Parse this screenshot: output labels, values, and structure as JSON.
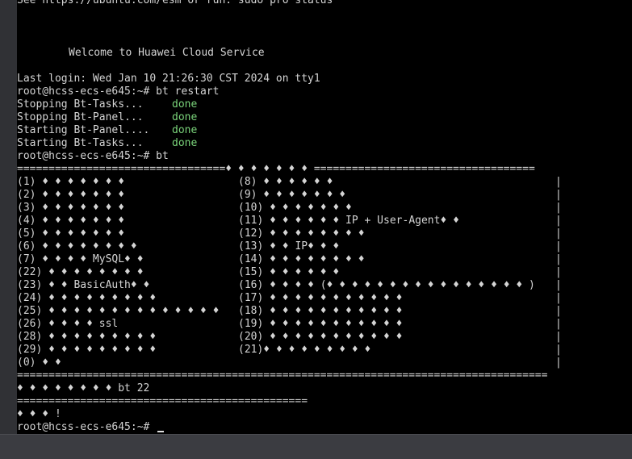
{
  "terminal": {
    "motd_hint": "See https://ubuntu.com/esm or run: sudo pro status",
    "welcome": "Welcome to Huawei Cloud Service",
    "last_login": "Last login: Wed Jan 10 21:26:30 CST 2024 on tty1",
    "prompt1": "root@hcss-ecs-e645:~# bt restart",
    "status": [
      {
        "label": "Stopping Bt-Tasks...",
        "state": "done"
      },
      {
        "label": "Stopping Bt-Panel...",
        "state": "done"
      },
      {
        "label": "Starting Bt-Panel....",
        "state": "done"
      },
      {
        "label": "Starting Bt-Tasks...",
        "state": "done"
      }
    ],
    "prompt2": "root@hcss-ecs-e645:~# bt",
    "menu_top": "=================================♦ ♦ ♦ ♦ ♦ ♦ ♦ ===================================",
    "menu": [
      {
        "left": "(1) ♦ ♦ ♦ ♦ ♦ ♦ ♦",
        "right": "(8) ♦ ♦ ♦ ♦ ♦ ♦"
      },
      {
        "left": "(2) ♦ ♦ ♦ ♦ ♦ ♦ ♦",
        "right": "(9) ♦ ♦ ♦ ♦ ♦ ♦ ♦"
      },
      {
        "left": "(3) ♦ ♦ ♦ ♦ ♦ ♦ ♦",
        "right": "(10) ♦ ♦ ♦ ♦ ♦ ♦ ♦"
      },
      {
        "left": "(4) ♦ ♦ ♦ ♦ ♦ ♦ ♦",
        "right": "(11) ♦ ♦ ♦ ♦ ♦ ♦ IP + User-Agent♦ ♦"
      },
      {
        "left": "(5) ♦ ♦ ♦ ♦ ♦ ♦ ♦",
        "right": "(12) ♦ ♦ ♦ ♦ ♦ ♦ ♦ ♦"
      },
      {
        "left": "(6) ♦ ♦ ♦ ♦ ♦ ♦ ♦ ♦",
        "right": "(13) ♦ ♦ IP♦ ♦ ♦"
      },
      {
        "left": "(7) ♦ ♦ ♦ ♦ MySQL♦ ♦",
        "right": "(14) ♦ ♦ ♦ ♦ ♦ ♦ ♦ ♦"
      },
      {
        "left": "(22) ♦ ♦ ♦ ♦ ♦ ♦ ♦ ♦",
        "right": "(15) ♦ ♦ ♦ ♦ ♦ ♦"
      },
      {
        "left": "(23) ♦ ♦ BasicAuth♦ ♦",
        "right": "(16) ♦ ♦ ♦ ♦ (♦ ♦ ♦ ♦ ♦ ♦ ♦ ♦ ♦ ♦ ♦ ♦ ♦ ♦ ♦ ♦ )"
      },
      {
        "left": "(24) ♦ ♦ ♦ ♦ ♦ ♦ ♦ ♦ ♦",
        "right": "(17) ♦ ♦ ♦ ♦ ♦ ♦ ♦ ♦ ♦ ♦ ♦"
      },
      {
        "left": "(25) ♦ ♦ ♦ ♦ ♦ ♦ ♦ ♦ ♦ ♦ ♦ ♦ ♦ ♦",
        "right": "(18) ♦ ♦ ♦ ♦ ♦ ♦ ♦ ♦ ♦ ♦ ♦"
      },
      {
        "left": "(26) ♦ ♦ ♦ ♦ ssl",
        "right": "(19) ♦ ♦ ♦ ♦ ♦ ♦ ♦ ♦ ♦ ♦ ♦"
      },
      {
        "left": "(28) ♦ ♦ ♦ ♦ ♦ ♦ ♦ ♦ ♦",
        "right": "(20) ♦ ♦ ♦ ♦ ♦ ♦ ♦ ♦ ♦ ♦ ♦"
      },
      {
        "left": "(29) ♦ ♦ ♦ ♦ ♦ ♦ ♦ ♦ ♦",
        "right": "(21)♦ ♦ ♦ ♦ ♦ ♦ ♦ ♦ ♦"
      },
      {
        "left": "(0) ♦ ♦",
        "right": ""
      }
    ],
    "menu_bottom": "====================================================================================",
    "hint": "♦ ♦ ♦ ♦ ♦ ♦ ♦ ♦ bt 22",
    "divider": "==============================================",
    "input_prompt": "♦ ♦ ♦ !",
    "prompt3": "root@hcss-ecs-e645:~# ",
    "vbar": "|",
    "colors": {
      "background": "#000000",
      "text": "#d4d4d4",
      "done": "#7ad37a"
    }
  }
}
